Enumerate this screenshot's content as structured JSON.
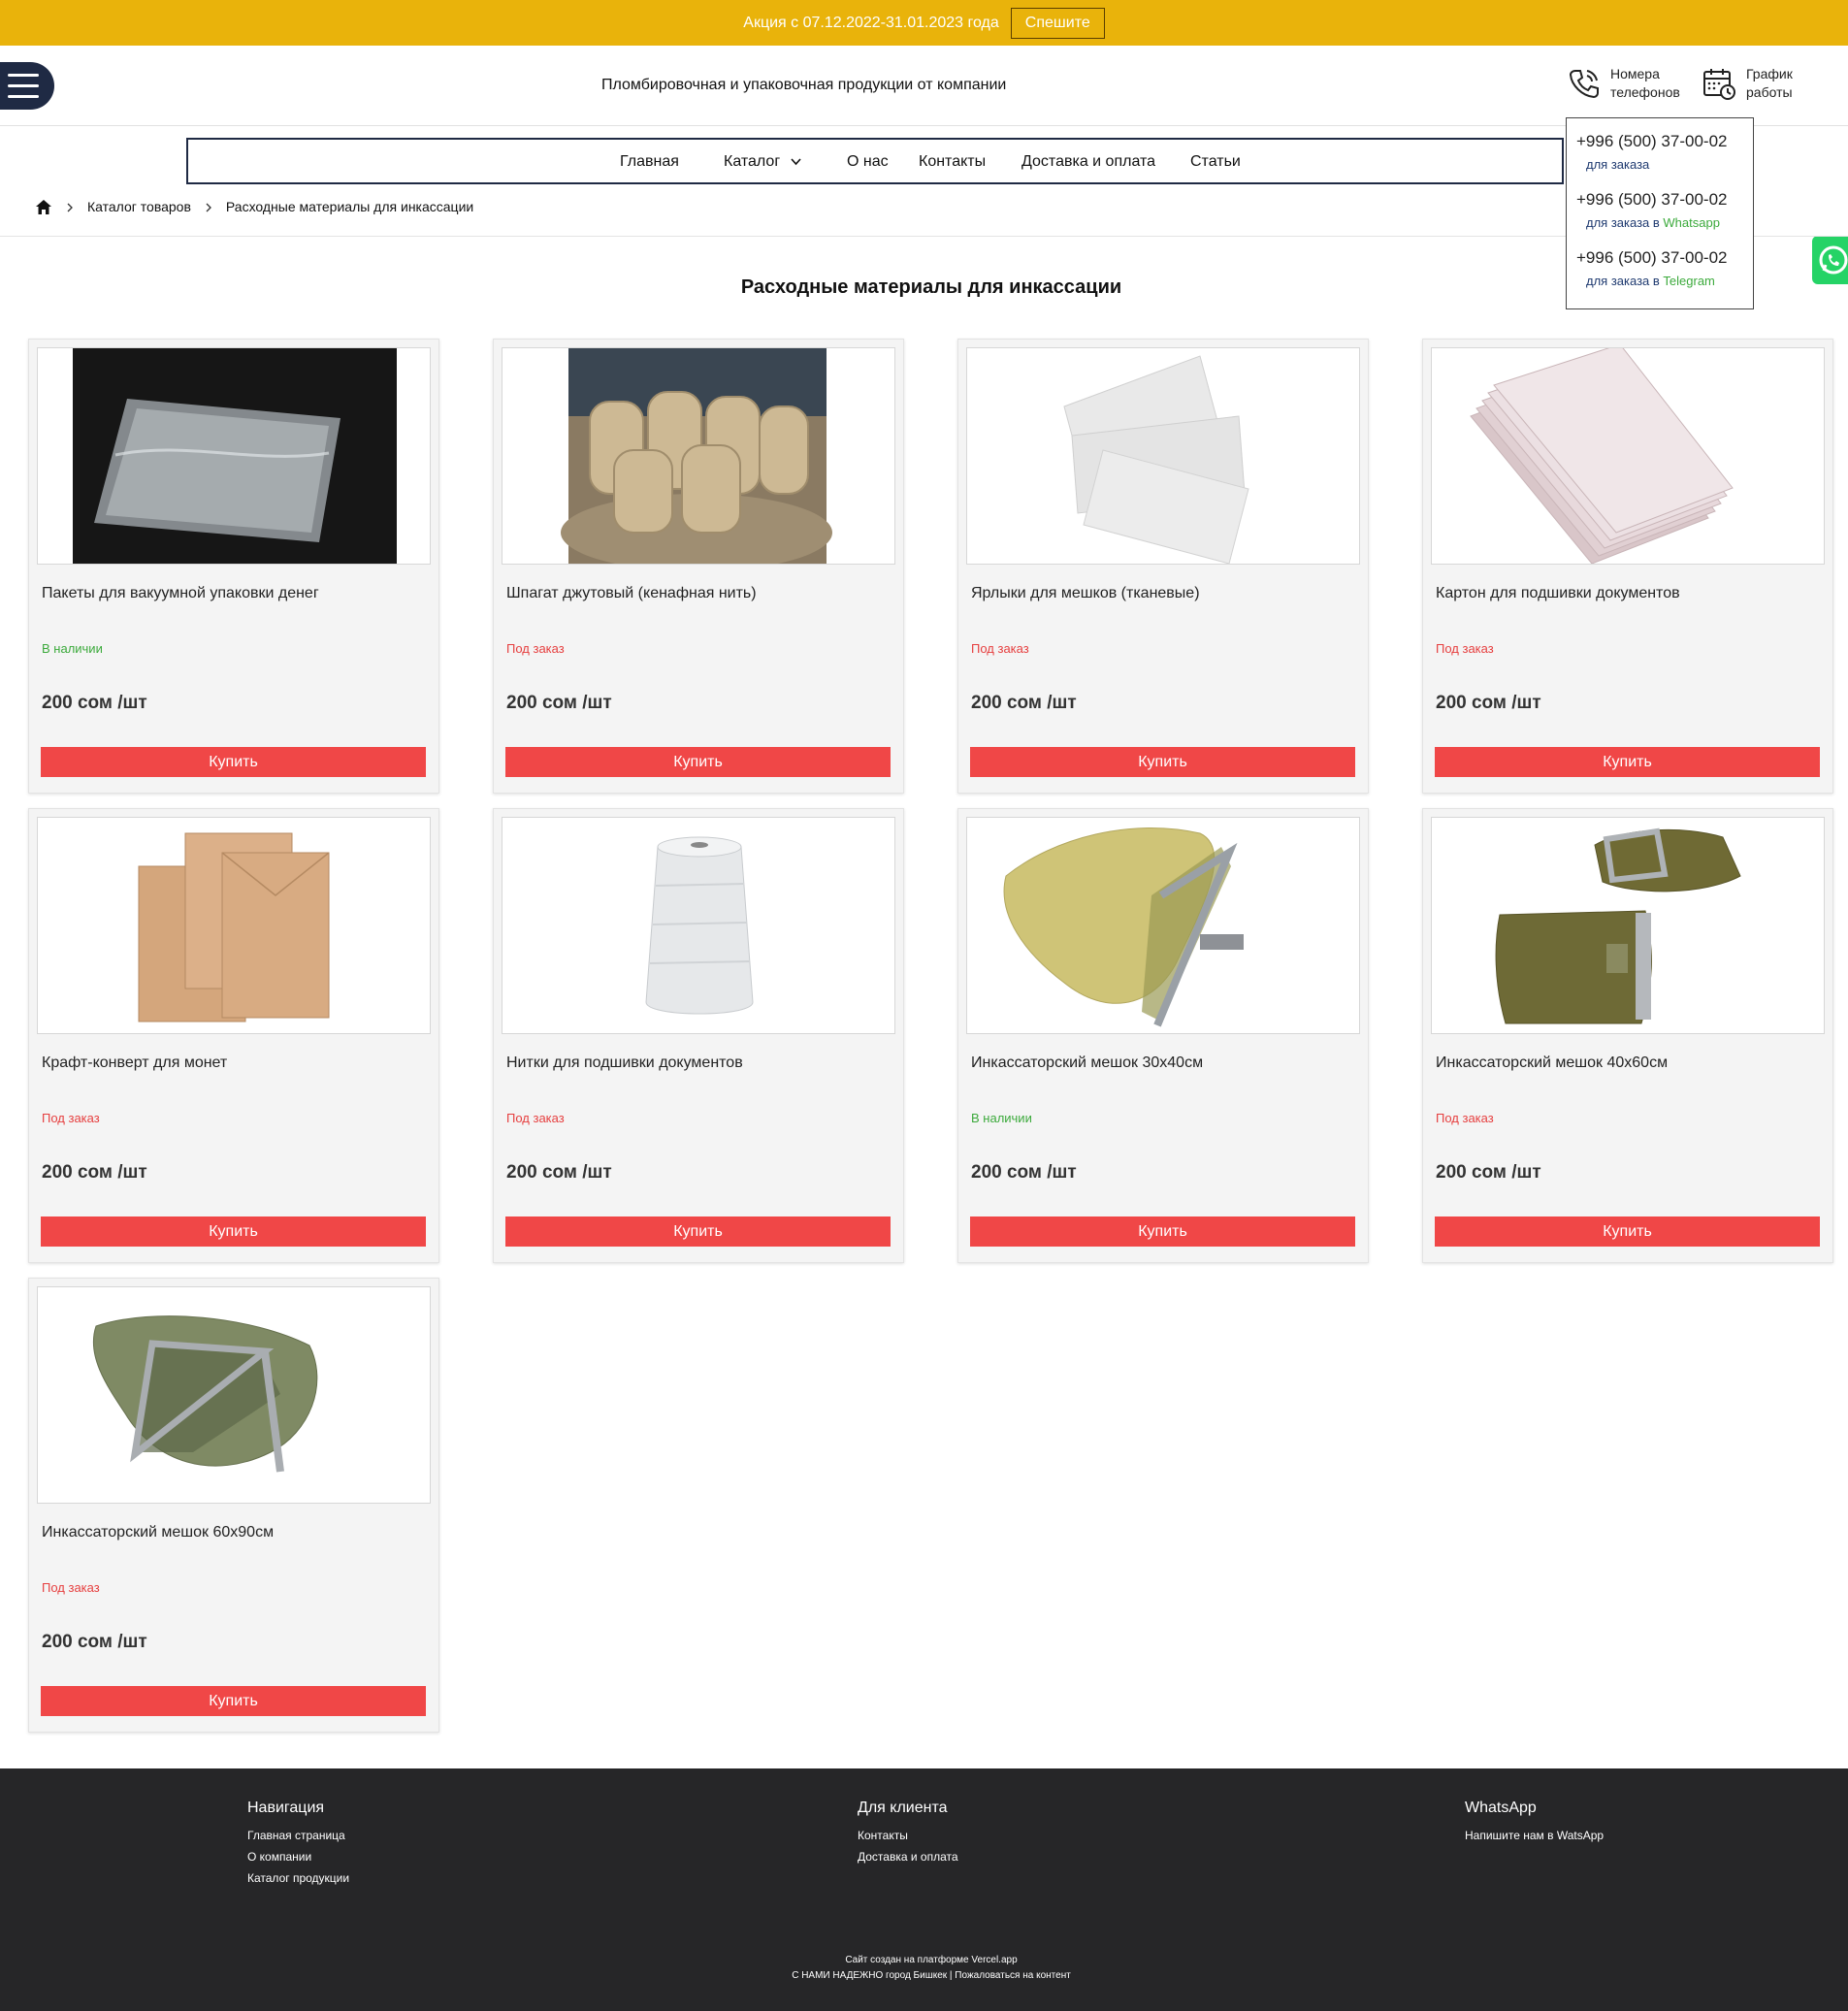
{
  "promo": {
    "text": "Акция с 07.12.2022-31.01.2023 года",
    "button": "Спешите"
  },
  "header": {
    "slogan": "Пломбировочная и упаковочная продукции от компании",
    "phones_label": "Номера телефонов",
    "schedule_label": "График работы"
  },
  "phone_popup": [
    {
      "number": "+996 (500) 37-00-02",
      "sub": "для заказа",
      "app": ""
    },
    {
      "number": "+996 (500) 37-00-02",
      "sub": "для заказа в",
      "app": "Whatsapp"
    },
    {
      "number": "+996 (500) 37-00-02",
      "sub": "для заказа в",
      "app": "Telegram"
    }
  ],
  "nav": [
    "Главная",
    "Каталог",
    "О нас",
    "Контакты",
    "Доставка и оплата",
    "Статьи"
  ],
  "breadcrumb": [
    "Каталог товаров",
    "Расходные материалы для инкассации"
  ],
  "page_title": "Расходные материалы для инкассации",
  "products": [
    {
      "name": "Пакеты для вакуумной упаковки денег",
      "stock": "В наличии",
      "price": "200 сом /шт",
      "buy": "Купить"
    },
    {
      "name": "Шпагат джутовый (кенафная нить)",
      "stock": "Под заказ",
      "price": "200 сом /шт",
      "buy": "Купить"
    },
    {
      "name": "Ярлыки для мешков (тканевые)",
      "stock": "Под заказ",
      "price": "200 сом /шт",
      "buy": "Купить"
    },
    {
      "name": "Картон для подшивки документов",
      "stock": "Под заказ",
      "price": "200 сом /шт",
      "buy": "Купить"
    },
    {
      "name": "Крафт-конверт для монет",
      "stock": "Под заказ",
      "price": "200 сом /шт",
      "buy": "Купить"
    },
    {
      "name": "Нитки для подшивки документов",
      "stock": "Под заказ",
      "price": "200 сом /шт",
      "buy": "Купить"
    },
    {
      "name": "Инкассаторский мешок 30х40см",
      "stock": "В наличии",
      "price": "200 сом /шт",
      "buy": "Купить"
    },
    {
      "name": "Инкассаторский мешок 40х60см",
      "stock": "Под заказ",
      "price": "200 сом /шт",
      "buy": "Купить"
    },
    {
      "name": "Инкассаторский мешок 60х90см",
      "stock": "Под заказ",
      "price": "200 сом /шт",
      "buy": "Купить"
    }
  ],
  "footer": {
    "nav_title": "Навигация",
    "nav_links": [
      "Главная страница",
      "О компании",
      "Каталог продукции"
    ],
    "client_title": "Для клиента",
    "client_links": [
      "Контакты",
      "Доставка и оплата"
    ],
    "wa_title": "WhatsApp",
    "wa_links": [
      "Напишите нам в WatsApp"
    ],
    "copy_line1": "Сайт создан на платформе Vercel.app",
    "copy_line2": "С НАМИ НАДЕЖНО город Бишкек | Пожаловаться на контент"
  },
  "colors": {
    "promo": "#e9b30b",
    "dark": "#1f2a44",
    "buy": "#f04747",
    "in_stock": "#3caa3c",
    "order": "#e63f3f",
    "footer": "#262628"
  }
}
